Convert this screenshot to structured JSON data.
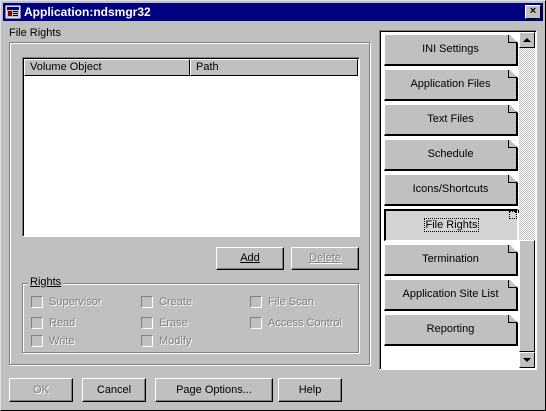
{
  "window": {
    "title": "Application:ndsmgr32",
    "close_glyph": "×"
  },
  "file_rights": {
    "section_label": "File Rights",
    "columns": [
      "Volume Object",
      "Path"
    ],
    "rows": [],
    "add_label": "Add",
    "delete_label": "Delete"
  },
  "rights": {
    "group_label": "Rights",
    "checkboxes": [
      {
        "label": "Supervisor",
        "checked": false,
        "enabled": false
      },
      {
        "label": "Create",
        "checked": false,
        "enabled": false
      },
      {
        "label": "File Scan",
        "checked": false,
        "enabled": false
      },
      {
        "label": "Read",
        "checked": false,
        "enabled": false
      },
      {
        "label": "Erase",
        "checked": false,
        "enabled": false
      },
      {
        "label": "Access Control",
        "checked": false,
        "enabled": false
      },
      {
        "label": "Write",
        "checked": false,
        "enabled": false
      },
      {
        "label": "Modify",
        "checked": false,
        "enabled": false
      }
    ]
  },
  "pages": {
    "items": [
      {
        "label": "INI Settings"
      },
      {
        "label": "Application Files"
      },
      {
        "label": "Text Files"
      },
      {
        "label": "Schedule"
      },
      {
        "label": "Icons/Shortcuts"
      },
      {
        "label": "File Rights",
        "active": true
      },
      {
        "label": "Termination"
      },
      {
        "label": "Application Site List"
      },
      {
        "label": "Reporting"
      }
    ],
    "active": "File Rights"
  },
  "footer": {
    "ok_label": "OK",
    "cancel_label": "Cancel",
    "page_options_label": "Page Options...",
    "help_label": "Help"
  },
  "colors": {
    "titlebar": "#000080",
    "face": "#c0c0c0",
    "disabled_text": "#808080"
  }
}
